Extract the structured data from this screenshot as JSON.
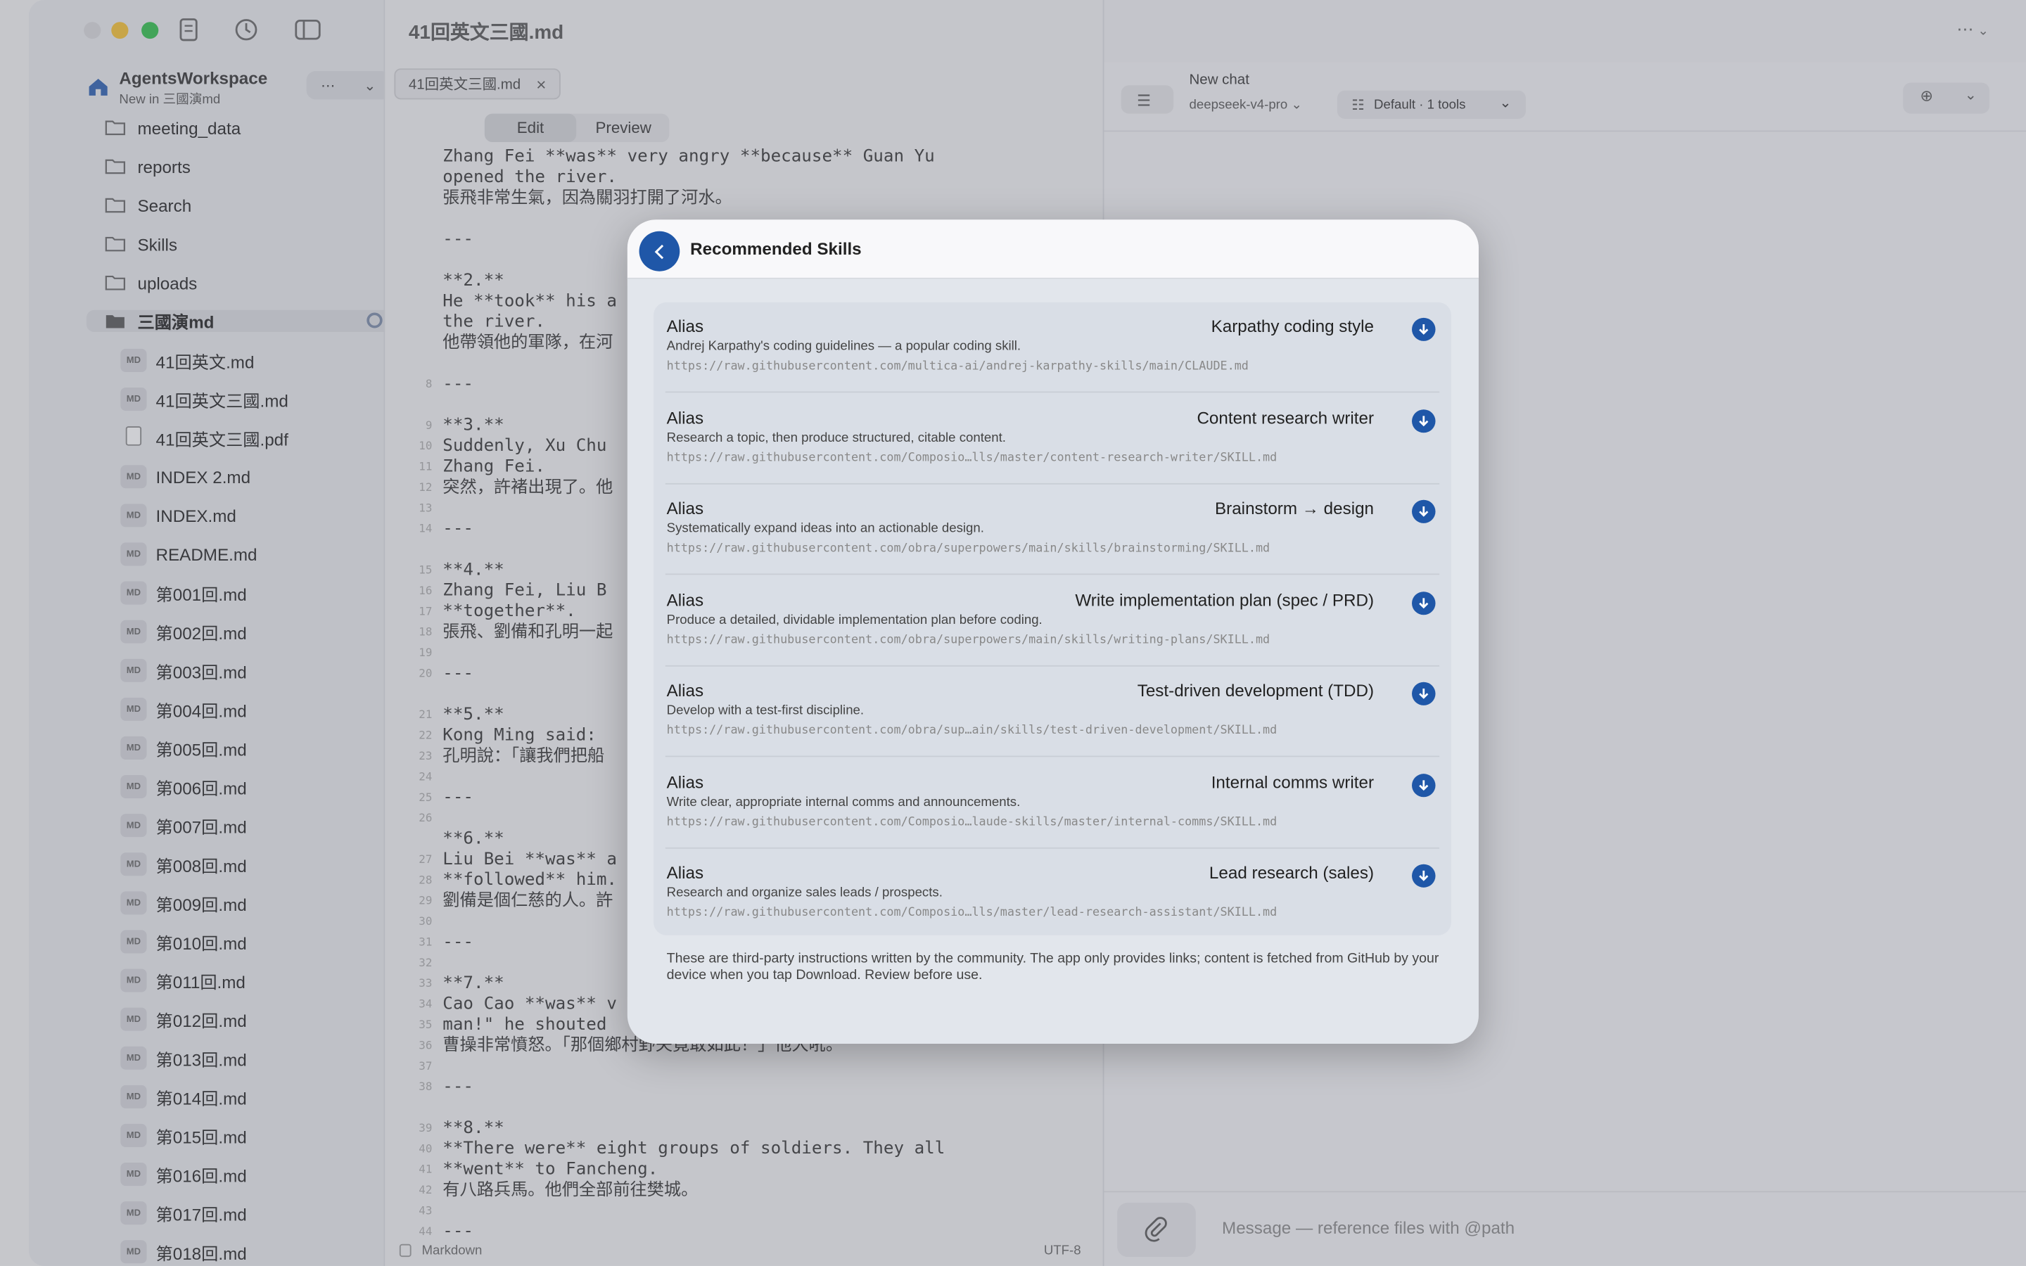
{
  "window": {
    "title": "41回英文三國.md"
  },
  "sidebar": {
    "workspace_name": "AgentsWorkspace",
    "workspace_sub": "New in 三國演md",
    "folders": [
      "meeting_data",
      "reports",
      "Search",
      "Skills",
      "uploads"
    ],
    "active_folder": "三國演md",
    "files": [
      {
        "type": "MD",
        "name": "41回英文.md"
      },
      {
        "type": "MD",
        "name": "41回英文三國.md"
      },
      {
        "type": "PDF",
        "name": "41回英文三國.pdf"
      },
      {
        "type": "MD",
        "name": "INDEX 2.md"
      },
      {
        "type": "MD",
        "name": "INDEX.md"
      },
      {
        "type": "MD",
        "name": "README.md"
      },
      {
        "type": "MD",
        "name": "第001回.md"
      },
      {
        "type": "MD",
        "name": "第002回.md"
      },
      {
        "type": "MD",
        "name": "第003回.md"
      },
      {
        "type": "MD",
        "name": "第004回.md"
      },
      {
        "type": "MD",
        "name": "第005回.md"
      },
      {
        "type": "MD",
        "name": "第006回.md"
      },
      {
        "type": "MD",
        "name": "第007回.md"
      },
      {
        "type": "MD",
        "name": "第008回.md"
      },
      {
        "type": "MD",
        "name": "第009回.md"
      },
      {
        "type": "MD",
        "name": "第010回.md"
      },
      {
        "type": "MD",
        "name": "第011回.md"
      },
      {
        "type": "MD",
        "name": "第012回.md"
      },
      {
        "type": "MD",
        "name": "第013回.md"
      },
      {
        "type": "MD",
        "name": "第014回.md"
      },
      {
        "type": "MD",
        "name": "第015回.md"
      },
      {
        "type": "MD",
        "name": "第016回.md"
      },
      {
        "type": "MD",
        "name": "第017回.md"
      },
      {
        "type": "MD",
        "name": "第018回.md"
      }
    ]
  },
  "editor": {
    "tab_label": "41回英文三國.md",
    "mode_edit": "Edit",
    "mode_preview": "Preview",
    "status_left": "Markdown",
    "status_right": "UTF-8",
    "lines": [
      {
        "n": "",
        "t": "Zhang Fei **was** very angry **because** Guan Yu"
      },
      {
        "n": "",
        "t": "opened the river."
      },
      {
        "n": "",
        "t": "張飛非常生氣，因為關羽打開了河水。"
      },
      {
        "n": "",
        "t": ""
      },
      {
        "n": "",
        "t": "---"
      },
      {
        "n": "",
        "t": ""
      },
      {
        "n": "",
        "t": "**2.**"
      },
      {
        "n": "",
        "t": "He **took** his a"
      },
      {
        "n": "",
        "t": "the river."
      },
      {
        "n": "",
        "t": "他帶領他的軍隊，在河"
      },
      {
        "n": "",
        "t": ""
      },
      {
        "n": "8",
        "t": "---"
      },
      {
        "n": "",
        "t": ""
      },
      {
        "n": "9",
        "t": "**3.**"
      },
      {
        "n": "10",
        "t": "Suddenly, Xu Chu"
      },
      {
        "n": "11",
        "t": "Zhang Fei."
      },
      {
        "n": "12",
        "t": "突然，許褚出現了。他"
      },
      {
        "n": "13",
        "t": ""
      },
      {
        "n": "14",
        "t": "---"
      },
      {
        "n": "",
        "t": ""
      },
      {
        "n": "15",
        "t": "**4.**"
      },
      {
        "n": "16",
        "t": "Zhang Fei, Liu B"
      },
      {
        "n": "17",
        "t": "**together**."
      },
      {
        "n": "18",
        "t": "張飛、劉備和孔明一起"
      },
      {
        "n": "19",
        "t": ""
      },
      {
        "n": "20",
        "t": "---"
      },
      {
        "n": "",
        "t": ""
      },
      {
        "n": "21",
        "t": "**5.**"
      },
      {
        "n": "22",
        "t": "Kong Ming said:"
      },
      {
        "n": "23",
        "t": "孔明說：「讓我們把船"
      },
      {
        "n": "24",
        "t": ""
      },
      {
        "n": "25",
        "t": "---"
      },
      {
        "n": "26",
        "t": ""
      },
      {
        "n": "",
        "t": "**6.**"
      },
      {
        "n": "27",
        "t": "Liu Bei **was** a"
      },
      {
        "n": "28",
        "t": "**followed** him."
      },
      {
        "n": "29",
        "t": "劉備是個仁慈的人。許"
      },
      {
        "n": "30",
        "t": ""
      },
      {
        "n": "31",
        "t": "---"
      },
      {
        "n": "32",
        "t": ""
      },
      {
        "n": "33",
        "t": "**7.**"
      },
      {
        "n": "34",
        "t": "Cao Cao **was** v"
      },
      {
        "n": "35",
        "t": "man!\" he shouted"
      },
      {
        "n": "36",
        "t": "曹操非常憤怒。「那個鄉村野夫竟敢如此！」他大吼。"
      },
      {
        "n": "37",
        "t": ""
      },
      {
        "n": "38",
        "t": "---"
      },
      {
        "n": "",
        "t": ""
      },
      {
        "n": "39",
        "t": "**8.**"
      },
      {
        "n": "40",
        "t": "**There were** eight groups of soldiers. They all"
      },
      {
        "n": "41",
        "t": "**went** to Fancheng."
      },
      {
        "n": "42",
        "t": "有八路兵馬。他們全部前往樊城。"
      },
      {
        "n": "43",
        "t": ""
      },
      {
        "n": "44",
        "t": "---"
      }
    ]
  },
  "chat": {
    "title": "New chat",
    "model": "deepseek-v4-pro",
    "tools": "Default · 1 tools",
    "placeholder": "Message — reference files with @path"
  },
  "modal": {
    "title": "Recommended Skills",
    "accent": "#1f57a8",
    "skills": [
      {
        "alias": "Alias",
        "name": "Karpathy coding style",
        "desc": "Andrej Karpathy's coding guidelines — a popular coding skill.",
        "url": "https://raw.githubusercontent.com/multica-ai/andrej-karpathy-skills/main/CLAUDE.md"
      },
      {
        "alias": "Alias",
        "name": "Content research writer",
        "desc": "Research a topic, then produce structured, citable content.",
        "url": "https://raw.githubusercontent.com/Composio…lls/master/content-research-writer/SKILL.md"
      },
      {
        "alias": "Alias",
        "name": "Brainstorm → design",
        "desc": "Systematically expand ideas into an actionable design.",
        "url": "https://raw.githubusercontent.com/obra/superpowers/main/skills/brainstorming/SKILL.md"
      },
      {
        "alias": "Alias",
        "name": "Write implementation plan (spec / PRD)",
        "desc": "Produce a detailed, dividable implementation plan before coding.",
        "url": "https://raw.githubusercontent.com/obra/superpowers/main/skills/writing-plans/SKILL.md"
      },
      {
        "alias": "Alias",
        "name": "Test-driven development (TDD)",
        "desc": "Develop with a test-first discipline.",
        "url": "https://raw.githubusercontent.com/obra/sup…ain/skills/test-driven-development/SKILL.md"
      },
      {
        "alias": "Alias",
        "name": "Internal comms writer",
        "desc": "Write clear, appropriate internal comms and announcements.",
        "url": "https://raw.githubusercontent.com/Composio…laude-skills/master/internal-comms/SKILL.md"
      },
      {
        "alias": "Alias",
        "name": "Lead research (sales)",
        "desc": "Research and organize sales leads / prospects.",
        "url": "https://raw.githubusercontent.com/Composio…lls/master/lead-research-assistant/SKILL.md"
      }
    ],
    "disclaimer": "These are third-party instructions written by the community. The app only provides links; content is fetched from GitHub by your device when you tap Download. Review before use."
  }
}
